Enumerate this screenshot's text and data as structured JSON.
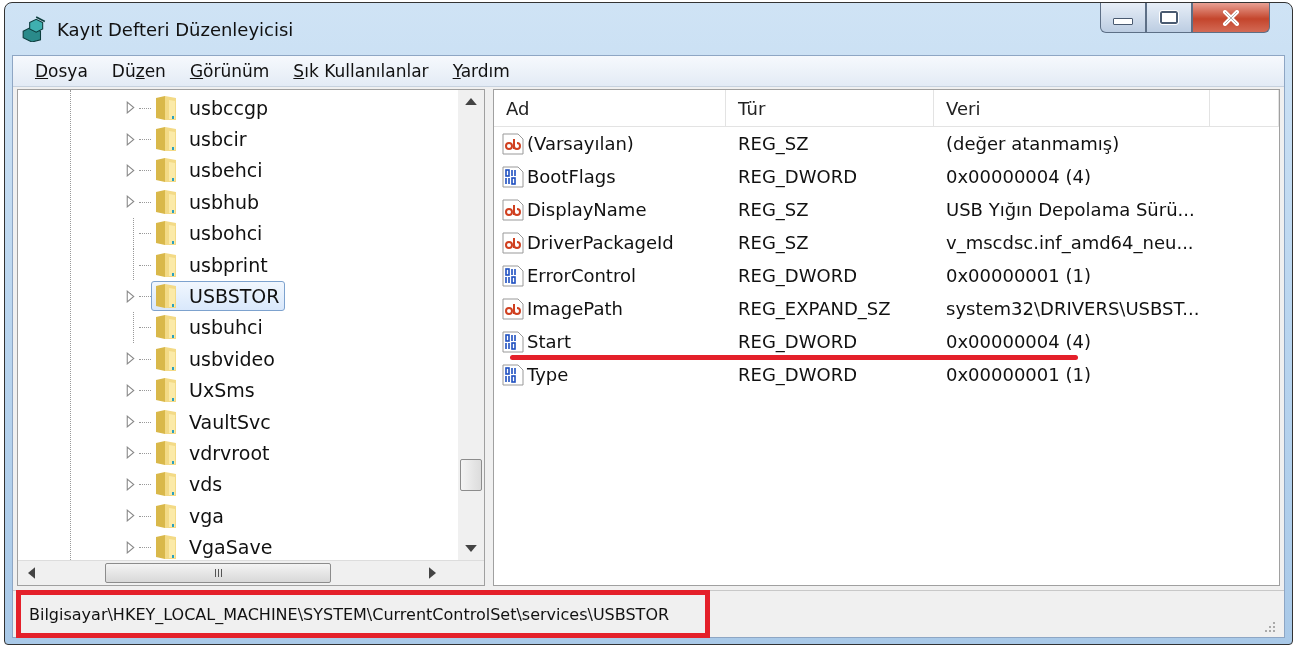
{
  "window": {
    "title": "Kayıt Defteri Düzenleyicisi"
  },
  "menu": [
    {
      "key": "D",
      "post": "osya"
    },
    {
      "pre": "Dü",
      "key": "z",
      "post": "en"
    },
    {
      "key": "G",
      "post": "örünüm"
    },
    {
      "key": "S",
      "post": "ık Kullanılanlar"
    },
    {
      "key": "Y",
      "post": "ardım"
    }
  ],
  "tree": [
    {
      "name": "usbccgp",
      "expandable": true,
      "selected": false
    },
    {
      "name": "usbcir",
      "expandable": true,
      "selected": false
    },
    {
      "name": "usbehci",
      "expandable": true,
      "selected": false
    },
    {
      "name": "usbhub",
      "expandable": true,
      "selected": false
    },
    {
      "name": "usbohci",
      "expandable": false,
      "selected": false
    },
    {
      "name": "usbprint",
      "expandable": false,
      "selected": false
    },
    {
      "name": "USBSTOR",
      "expandable": true,
      "selected": true
    },
    {
      "name": "usbuhci",
      "expandable": false,
      "selected": false
    },
    {
      "name": "usbvideo",
      "expandable": true,
      "selected": false
    },
    {
      "name": "UxSms",
      "expandable": true,
      "selected": false
    },
    {
      "name": "VaultSvc",
      "expandable": true,
      "selected": false
    },
    {
      "name": "vdrvroot",
      "expandable": true,
      "selected": false
    },
    {
      "name": "vds",
      "expandable": true,
      "selected": false
    },
    {
      "name": "vga",
      "expandable": true,
      "selected": false
    },
    {
      "name": "VgaSave",
      "expandable": true,
      "selected": false
    }
  ],
  "table": {
    "columns": [
      "Ad",
      "Tür",
      "Veri"
    ],
    "rows": [
      {
        "kind": "string",
        "name": "(Varsayılan)",
        "type": "REG_SZ",
        "data": "(değer atanmamış)",
        "underlined": false
      },
      {
        "kind": "binary",
        "name": "BootFlags",
        "type": "REG_DWORD",
        "data": "0x00000004 (4)",
        "underlined": false
      },
      {
        "kind": "string",
        "name": "DisplayName",
        "type": "REG_SZ",
        "data": "USB Yığın Depolama Sürü...",
        "underlined": false
      },
      {
        "kind": "string",
        "name": "DriverPackageId",
        "type": "REG_SZ",
        "data": "v_mscdsc.inf_amd64_neu...",
        "underlined": false
      },
      {
        "kind": "binary",
        "name": "ErrorControl",
        "type": "REG_DWORD",
        "data": "0x00000001 (1)",
        "underlined": false
      },
      {
        "kind": "string",
        "name": "ImagePath",
        "type": "REG_EXPAND_SZ",
        "data": "system32\\DRIVERS\\USBST...",
        "underlined": false
      },
      {
        "kind": "binary",
        "name": "Start",
        "type": "REG_DWORD",
        "data": "0x00000004 (4)",
        "underlined": true
      },
      {
        "kind": "binary",
        "name": "Type",
        "type": "REG_DWORD",
        "data": "0x00000001 (1)",
        "underlined": false
      }
    ]
  },
  "status_bar": {
    "path": "Bilgisayar\\HKEY_LOCAL_MACHINE\\SYSTEM\\CurrentControlSet\\services\\USBSTOR",
    "boxed": true
  }
}
